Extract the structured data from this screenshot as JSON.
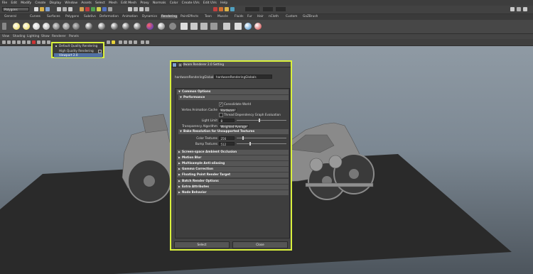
{
  "menubar": [
    "File",
    "Edit",
    "Modify",
    "Create",
    "Display",
    "Window",
    "Assets",
    "Select",
    "Mesh",
    "Edit Mesh",
    "Proxy",
    "Normals",
    "Color",
    "Create UVs",
    "Edit UVs",
    "Help"
  ],
  "statusline": {
    "mode": "Polygons"
  },
  "shelf_tabs": [
    "General",
    "Curves",
    "Surfaces",
    "Polygons",
    "Subdivs",
    "Deformation",
    "Animation",
    "Dynamics",
    "Rendering",
    "PaintEffects",
    "Toon",
    "Muscle",
    "Fluids",
    "Fur",
    "Hair",
    "nCloth",
    "Custom",
    "GoZBrush"
  ],
  "active_shelf_tab": "Rendering",
  "panel_menu": [
    "View",
    "Shading",
    "Lighting",
    "Show",
    "Renderer",
    "Panels"
  ],
  "renderer_menu": {
    "items": [
      {
        "label": "Default Quality Rendering",
        "selected": false,
        "radio": true
      },
      {
        "label": "High Quality Rendering",
        "selected": false,
        "radio": false
      },
      {
        "label": "Viewport 2.0",
        "selected": true,
        "radio": false
      }
    ]
  },
  "dialog": {
    "title": "Hardware Renderer 2.0 Setting",
    "node_label": "hardwareRenderingGlobals",
    "node_value": "hardwareRenderingGlobals",
    "sections": {
      "common": "Common Options",
      "performance": "Performance",
      "bake": "Bake Resolution for Unsupported Textures",
      "ssao": "Screen-space Ambient Occlusion",
      "motion_blur": "Motion Blur",
      "msaa": "Multisample Anti-aliasing",
      "gamma": "Gamma Correction",
      "fp_target": "Floating Point Render Target",
      "batch": "Batch Render Options",
      "extra": "Extra Attributes",
      "node_behavior": "Node Behavior"
    },
    "consolidate_world": {
      "label": "Consolidate World",
      "checked": true
    },
    "vertex_cache": {
      "label": "Vertex Animation Cache",
      "value": "Hardware"
    },
    "thread_dep": {
      "label": "Thread Dependency Graph Evaluation",
      "checked": false
    },
    "light_limit": {
      "label": "Light Limit",
      "value": "8"
    },
    "transparency": {
      "label": "Transparency Algorithm",
      "value": "Weighted Average"
    },
    "color_textures": {
      "label": "Color Textures",
      "value": "256"
    },
    "bump_textures": {
      "label": "Bump Textures",
      "value": "512"
    },
    "select_button": "Select",
    "close_button": "Close"
  }
}
